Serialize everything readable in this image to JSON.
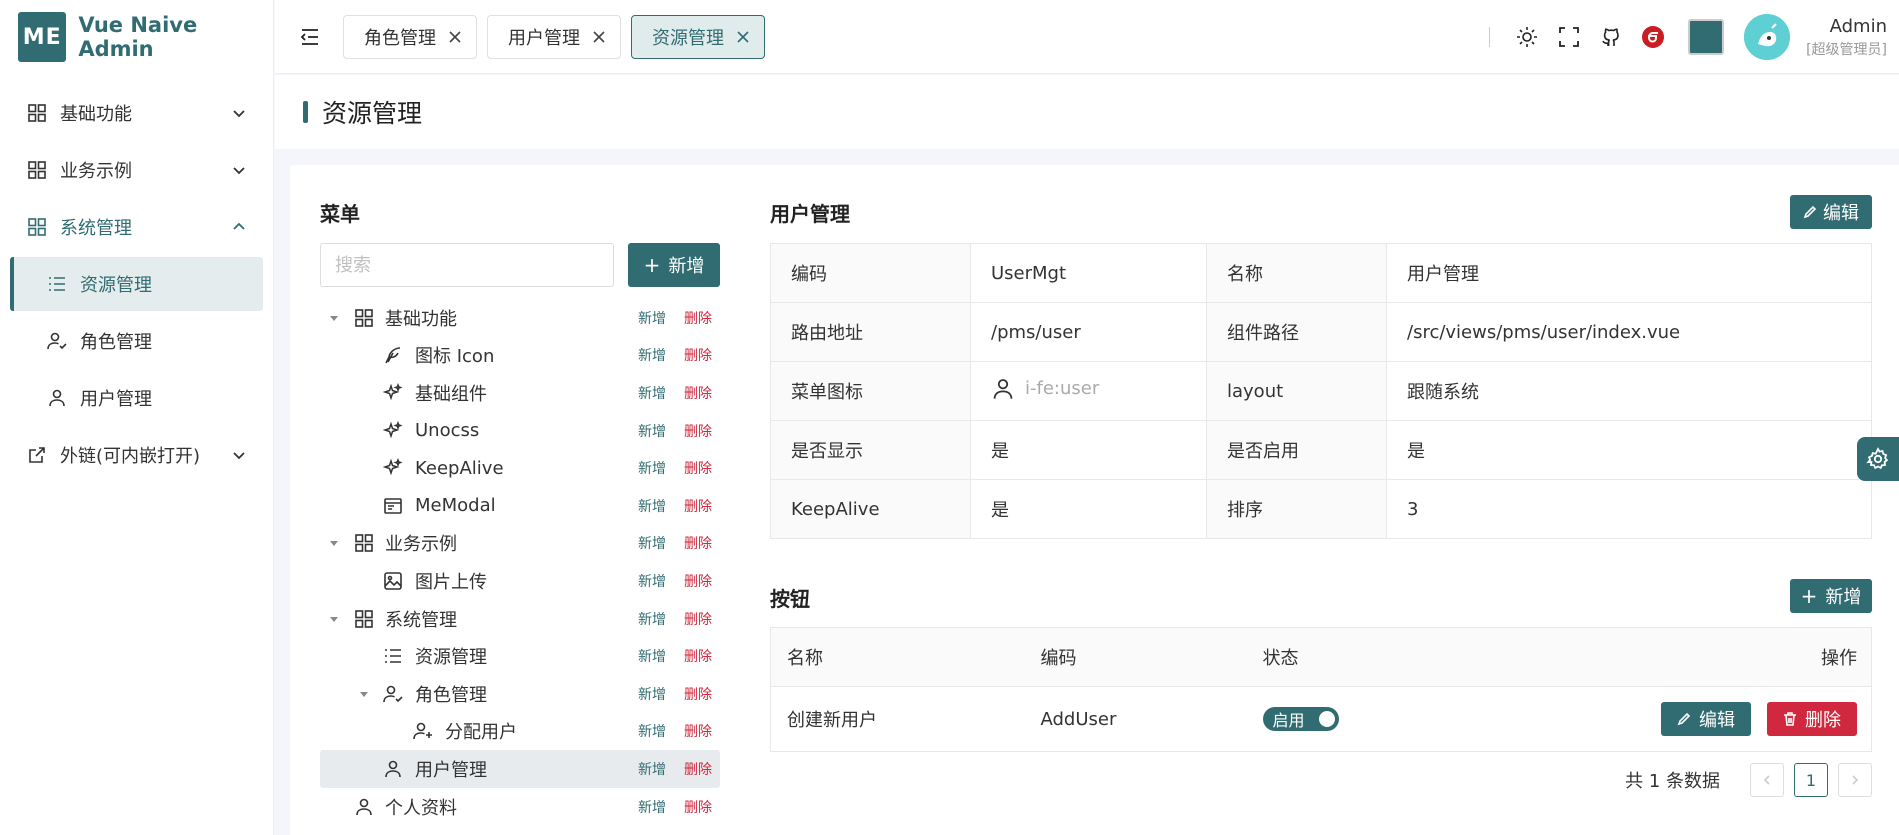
{
  "app": {
    "logo_mark": "ME",
    "title": "Vue Naive Admin"
  },
  "sidebar": {
    "items": [
      {
        "label": "基础功能",
        "icon": "grid-icon"
      },
      {
        "label": "业务示例",
        "icon": "grid-icon"
      },
      {
        "label": "系统管理",
        "icon": "grid-icon"
      },
      {
        "label": "资源管理",
        "icon": "list-icon"
      },
      {
        "label": "角色管理",
        "icon": "user-check-icon"
      },
      {
        "label": "用户管理",
        "icon": "user-icon"
      },
      {
        "label": "外链(可内嵌打开)",
        "icon": "external-link-icon"
      }
    ]
  },
  "header": {
    "tabs": [
      {
        "label": "角色管理"
      },
      {
        "label": "用户管理"
      },
      {
        "label": "资源管理"
      }
    ],
    "user_name": "Admin",
    "user_role": "[超级管理员]",
    "accent_color": "#316c72"
  },
  "page": {
    "title": "资源管理"
  },
  "menu_panel": {
    "title": "菜单",
    "search_placeholder": "搜索",
    "add_label": "新增",
    "action_add": "新增",
    "action_delete": "删除",
    "tree": [
      {
        "label": "基础功能",
        "icon": "grid-icon",
        "expanded": true
      },
      {
        "label": "图标 Icon",
        "icon": "feather-icon"
      },
      {
        "label": "基础组件",
        "icon": "sparkle-icon"
      },
      {
        "label": "Unocss",
        "icon": "sparkle-icon"
      },
      {
        "label": "KeepAlive",
        "icon": "sparkle-icon"
      },
      {
        "label": "MeModal",
        "icon": "window-icon"
      },
      {
        "label": "业务示例",
        "icon": "grid-icon",
        "expanded": true
      },
      {
        "label": "图片上传",
        "icon": "image-icon"
      },
      {
        "label": "系统管理",
        "icon": "grid-icon",
        "expanded": true
      },
      {
        "label": "资源管理",
        "icon": "list-icon"
      },
      {
        "label": "角色管理",
        "icon": "user-check-icon",
        "expanded": true
      },
      {
        "label": "分配用户",
        "icon": "user-plus-icon"
      },
      {
        "label": "用户管理",
        "icon": "user-icon",
        "selected": true
      },
      {
        "label": "个人资料",
        "icon": "user-icon"
      }
    ]
  },
  "detail": {
    "title": "用户管理",
    "edit_label": "编辑",
    "rows": [
      {
        "k1": "编码",
        "v1": "UserMgt",
        "k2": "名称",
        "v2": "用户管理"
      },
      {
        "k1": "路由地址",
        "v1": "/pms/user",
        "k2": "组件路径",
        "v2": "/src/views/pms/user/index.vue"
      },
      {
        "k1": "菜单图标",
        "v1": "i-fe:user",
        "k2": "layout",
        "v2": "跟随系统"
      },
      {
        "k1": "是否显示",
        "v1": "是",
        "k2": "是否启用",
        "v2": "是"
      },
      {
        "k1": "KeepAlive",
        "v1": "是",
        "k2": "排序",
        "v2": "3"
      }
    ]
  },
  "buttons": {
    "title": "按钮",
    "add_label": "新增",
    "columns": {
      "name": "名称",
      "code": "编码",
      "status": "状态",
      "ops": "操作"
    },
    "rows": [
      {
        "name": "创建新用户",
        "code": "AddUser",
        "status": "启用",
        "edit": "编辑",
        "delete": "删除"
      }
    ],
    "pager": {
      "total": "共 1 条数据",
      "page": "1"
    }
  }
}
